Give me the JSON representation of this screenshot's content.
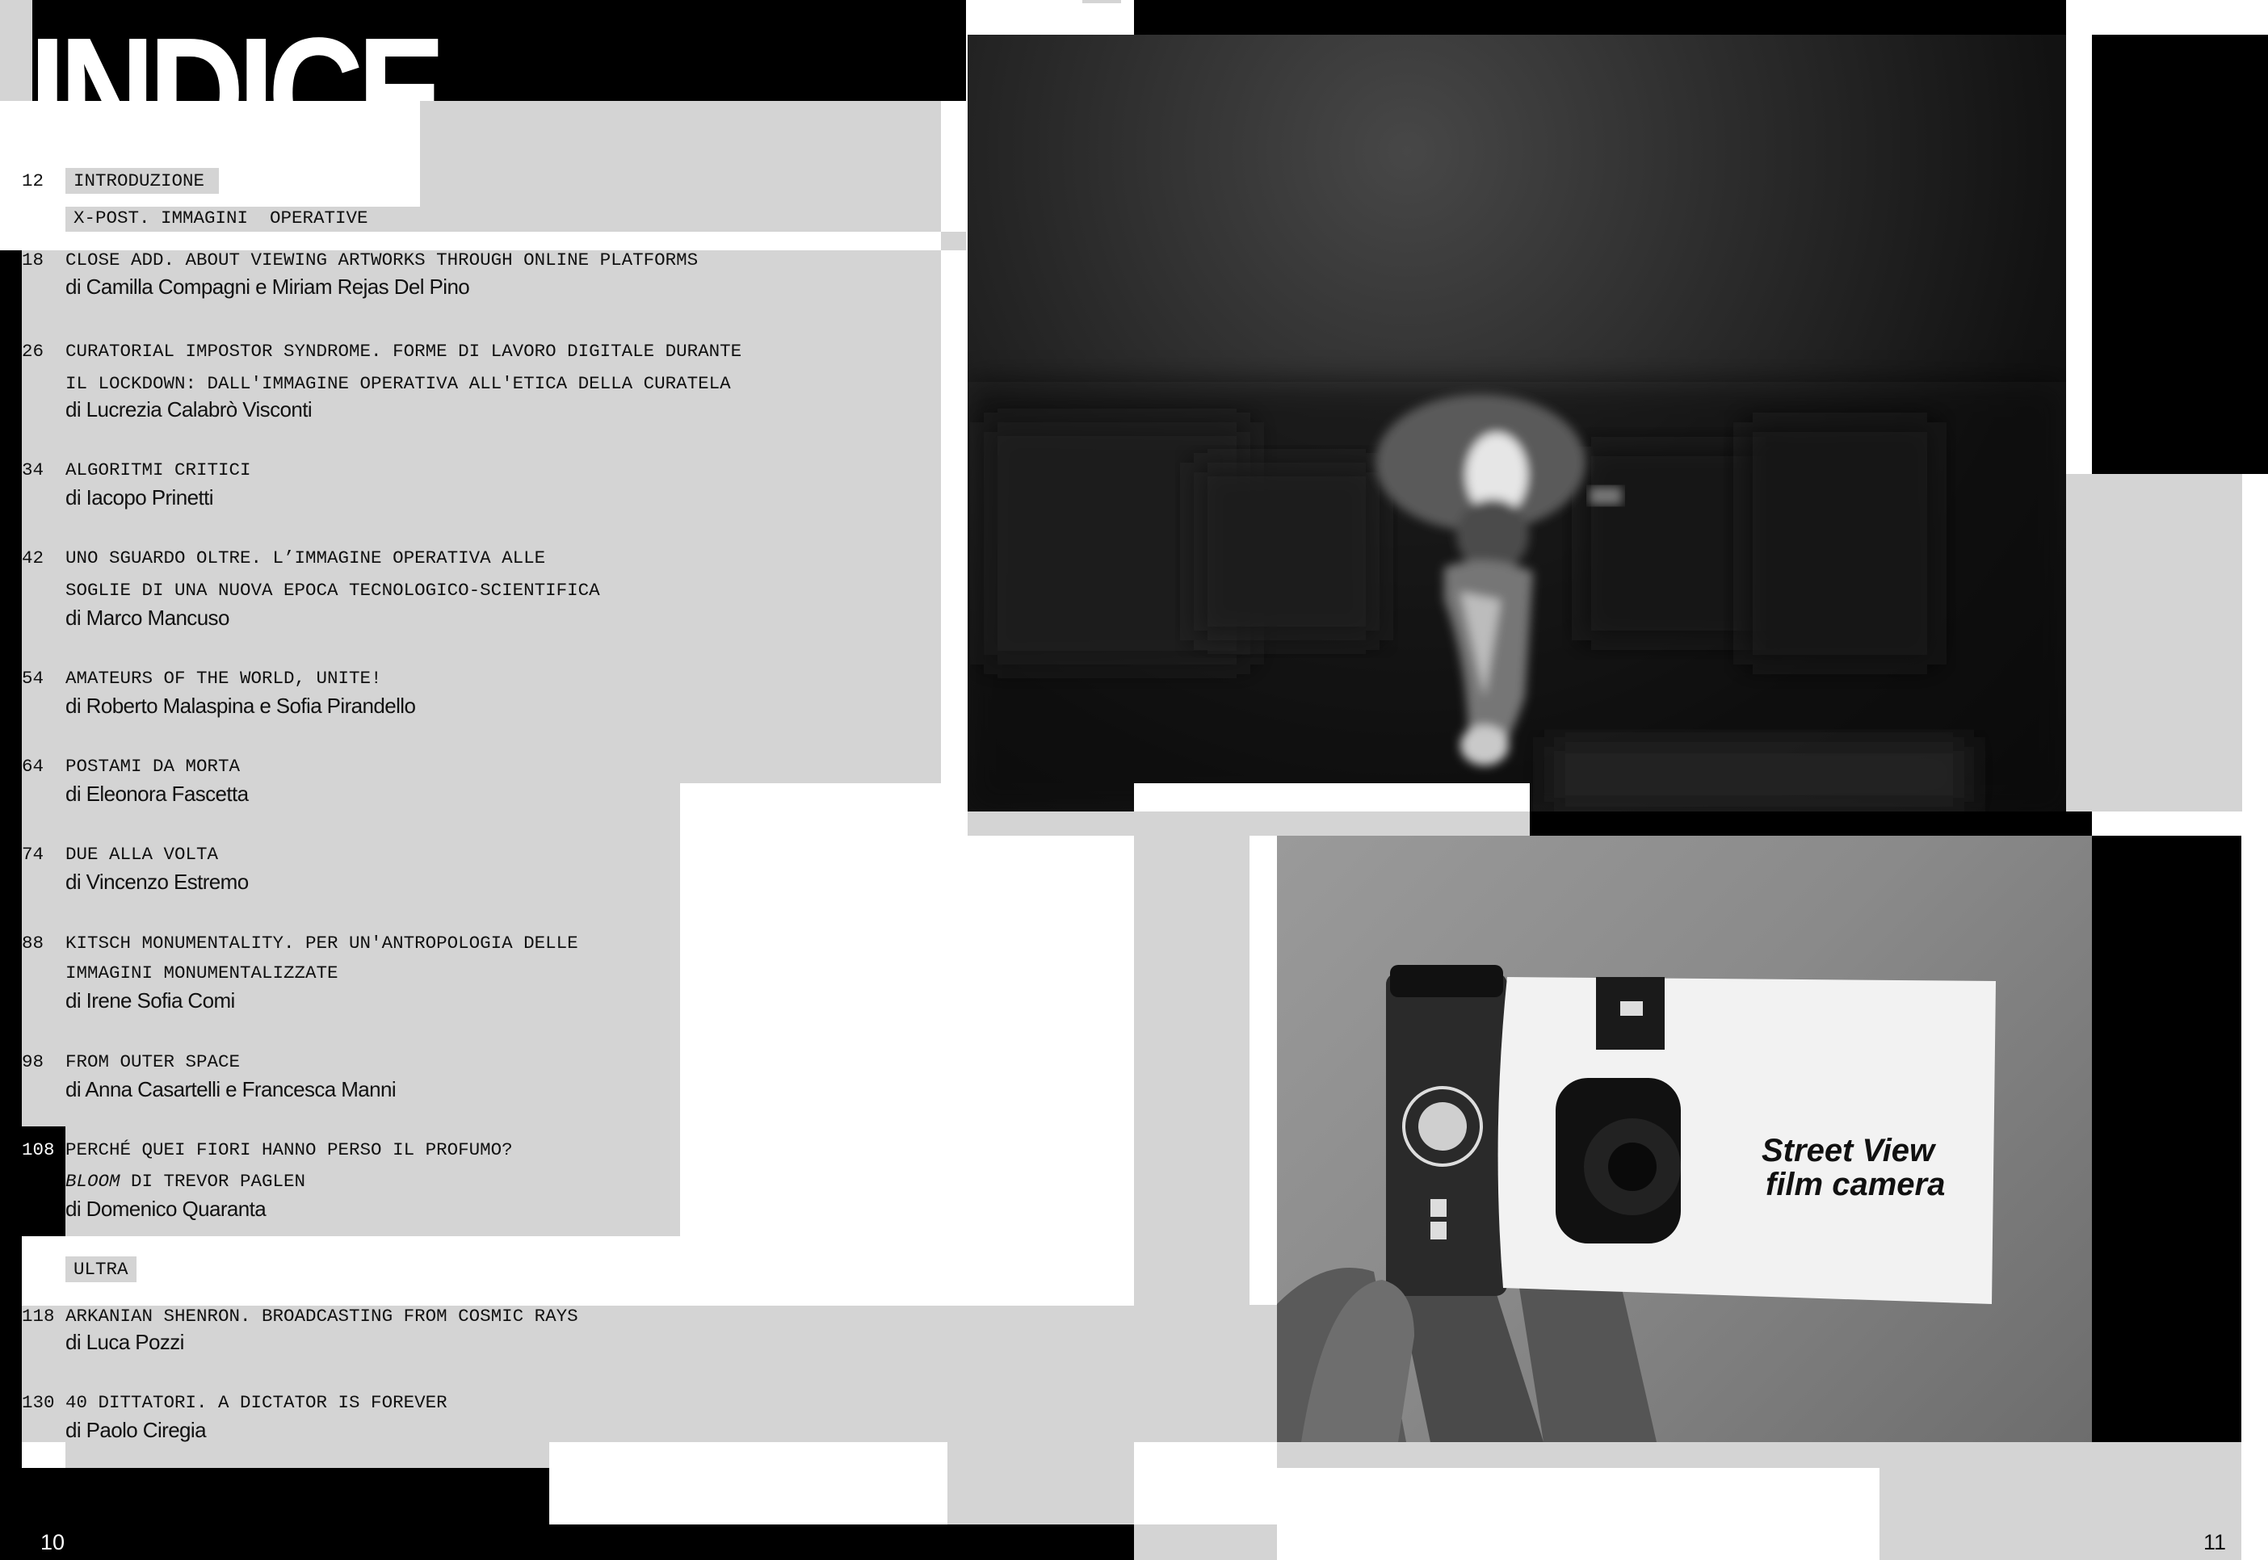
{
  "spread": {
    "title": "INDICE",
    "page_left": "10",
    "page_right": "11"
  },
  "toc": {
    "intro": {
      "page": "12",
      "label": "INTRODUZIONE"
    },
    "section_1": "X-POST. IMMAGINI  OPERATIVE",
    "entries": [
      {
        "page": "18",
        "title": [
          "CLOSE ADD. ABOUT VIEWING ARTWORKS THROUGH ONLINE PLATFORMS"
        ],
        "author": "di Camilla Compagni e Miriam Rejas Del Pino"
      },
      {
        "page": "26",
        "title": [
          "CURATORIAL IMPOSTOR SYNDROME. FORME DI LAVORO DIGITALE DURANTE",
          "IL LOCKDOWN: DALL'IMMAGINE OPERATIVA ALL'ETICA DELLA CURATELA"
        ],
        "author": "di Lucrezia Calabrò Visconti"
      },
      {
        "page": "34",
        "title": [
          "ALGORITMI CRITICI"
        ],
        "author": "di Iacopo Prinetti"
      },
      {
        "page": "42",
        "title": [
          "UNO SGUARDO OLTRE. L’IMMAGINE OPERATIVA ALLE",
          "SOGLIE DI UNA NUOVA EPOCA TECNOLOGICO-SCIENTIFICA"
        ],
        "author": "di Marco Mancuso"
      },
      {
        "page": "54",
        "title": [
          "AMATEURS OF THE WORLD, UNITE!"
        ],
        "author": "di Roberto Malaspina e Sofia Pirandello"
      },
      {
        "page": "64",
        "title": [
          "POSTAMI DA MORTA"
        ],
        "author": "di Eleonora Fascetta"
      },
      {
        "page": "74",
        "title": [
          "DUE ALLA VOLTA"
        ],
        "author": "di Vincenzo Estremo"
      },
      {
        "page": "88",
        "title": [
          "KITSCH MONUMENTALITY. PER UN'ANTROPOLOGIA DELLE",
          "IMMAGINI MONUMENTALIZZATE"
        ],
        "author": "di Irene Sofia Comi"
      },
      {
        "page": "98",
        "title": [
          "FROM OUTER SPACE"
        ],
        "author": "di Anna Casartelli e Francesca Manni"
      },
      {
        "page": "108",
        "title": [
          "PERCHÉ QUEI FIORI HANNO PERSO IL PROFUMO?",
          " DI TREVOR PAGLEN"
        ],
        "title_italic": "BLOOM",
        "author": "di Domenico Quaranta"
      }
    ],
    "section_2": "ULTRA",
    "entries_2": [
      {
        "page": "118",
        "title": [
          "ARKANIAN SHENRON. BROADCASTING FROM COSMIC RAYS"
        ],
        "author": "di Luca Pozzi"
      },
      {
        "page": "130",
        "title": [
          "40 DITTATORI. A DICTATOR IS FOREVER"
        ],
        "author": "di Paolo Ciregia"
      }
    ]
  },
  "photos": {
    "camera_label": [
      "Street View",
      "film camera"
    ]
  },
  "colors": {
    "black": "#000000",
    "gray": "#d4d4d4",
    "white": "#ffffff"
  }
}
